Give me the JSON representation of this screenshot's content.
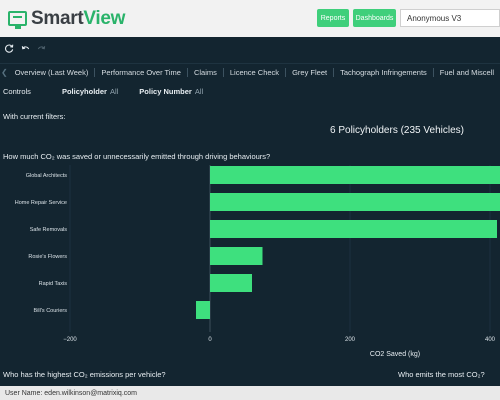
{
  "header": {
    "logo_smart": "Smart",
    "logo_view": "View",
    "reports_label": "Reports",
    "dashboards_label": "Dashboards",
    "account_select": "Anonymous V3"
  },
  "toolbar": {
    "refresh_icon": "refresh-icon",
    "undo_icon": "undo-icon",
    "redo_icon": "redo-icon"
  },
  "tabs": [
    {
      "label": "Overview (Last Week)"
    },
    {
      "label": "Performance Over Time"
    },
    {
      "label": "Claims"
    },
    {
      "label": "Licence Check"
    },
    {
      "label": "Grey Fleet"
    },
    {
      "label": "Tachograph Infringements"
    },
    {
      "label": "Fuel and Miscell"
    }
  ],
  "controls": {
    "label": "Controls",
    "filters": [
      {
        "key": "Policyholder",
        "value": "All"
      },
      {
        "key": "Policy Number",
        "value": "All"
      }
    ]
  },
  "current_filters_label": "With current filters:",
  "summary": "6 Policyholders (235 Vehicles)",
  "chart_question": "How much CO₂ was saved or unnecessarily emitted through driving behaviours?",
  "chart_data": {
    "type": "bar",
    "orientation": "horizontal",
    "categories": [
      "Global Architects",
      "Home Repair Service",
      "Safe Removals",
      "Rosie's Flowers",
      "Rapid Taxis",
      "Bill's Couriers"
    ],
    "values": [
      415,
      415,
      410,
      75,
      60,
      -20
    ],
    "xlabel": "CO2 Saved (kg)",
    "xlim": [
      -200,
      415
    ],
    "xticks": [
      -200,
      0,
      200,
      400
    ],
    "bar_color": "#3ee07e"
  },
  "question_2": "Who has the highest CO₂ emissions per vehicle?",
  "question_3": "Who emits the most CO₂?",
  "status": "User Name: eden.wilkinson@matrixiq.com"
}
